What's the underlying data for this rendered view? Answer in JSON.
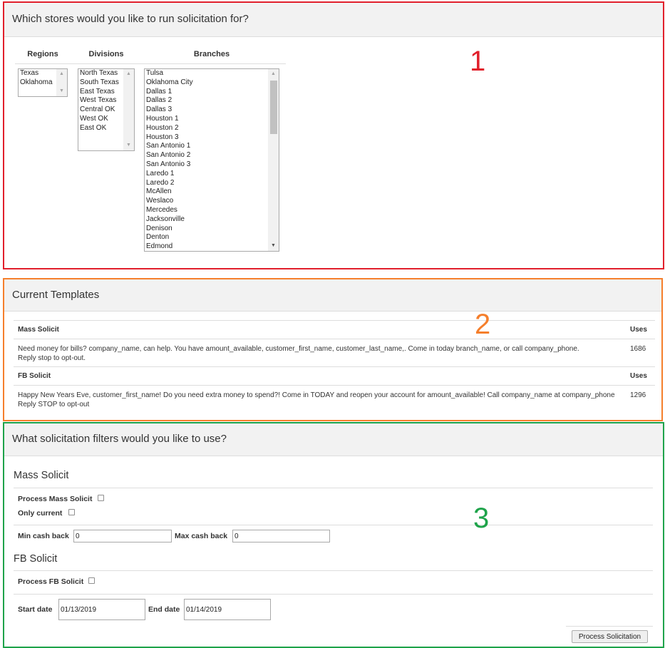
{
  "colors": {
    "outline1": "#e11f2b",
    "outline2": "#f57f2c",
    "outline3": "#1ea34a"
  },
  "annotations": {
    "one": "1",
    "two": "2",
    "three": "3"
  },
  "stores": {
    "title": "Which stores would you like to run solicitation for?",
    "regions_label": "Regions",
    "divisions_label": "Divisions",
    "branches_label": "Branches",
    "regions": [
      "Texas",
      "Oklahoma"
    ],
    "divisions": [
      "North Texas",
      "South Texas",
      "East Texas",
      "West Texas",
      "Central OK",
      "West OK",
      "East OK"
    ],
    "branches": [
      "Tulsa",
      "Oklahoma City",
      "Dallas 1",
      "Dallas 2",
      "Dallas 3",
      "Houston 1",
      "Houston 2",
      "Houston 3",
      "San Antonio 1",
      "San Antonio 2",
      "San Antonio 3",
      "Laredo 1",
      "Laredo 2",
      "McAllen",
      "Weslaco",
      "Mercedes",
      "Jacksonville",
      "Denison",
      "Denton",
      "Edmond"
    ]
  },
  "templates": {
    "title": "Current Templates",
    "uses_label": "Uses",
    "items": [
      {
        "name": "Mass Solicit",
        "text": "Need money for bills? company_name, can help. You have amount_available, customer_first_name, customer_last_name,. Come in today branch_name, or call company_phone. Reply stop to opt-out.",
        "uses": "1686"
      },
      {
        "name": "FB Solicit",
        "text": "Happy New Years Eve, customer_first_name! Do you need extra money to spend?! Come in TODAY and reopen your account for amount_available! Call company_name at company_phone Reply STOP to opt-out",
        "uses": "1296"
      }
    ]
  },
  "filters": {
    "title": "What solicitation filters would you like to use?",
    "mass": {
      "heading": "Mass Solicit",
      "process_label": "Process Mass Solicit",
      "only_current_label": "Only current",
      "min_label": "Min cash back",
      "min_value": "0",
      "max_label": "Max cash back",
      "max_value": "0"
    },
    "fb": {
      "heading": "FB Solicit",
      "process_label": "Process FB Solicit",
      "start_label": "Start date",
      "start_value": "01/13/2019",
      "end_label": "End date",
      "end_value": "01/14/2019"
    },
    "submit_label": "Process Solicitation"
  }
}
